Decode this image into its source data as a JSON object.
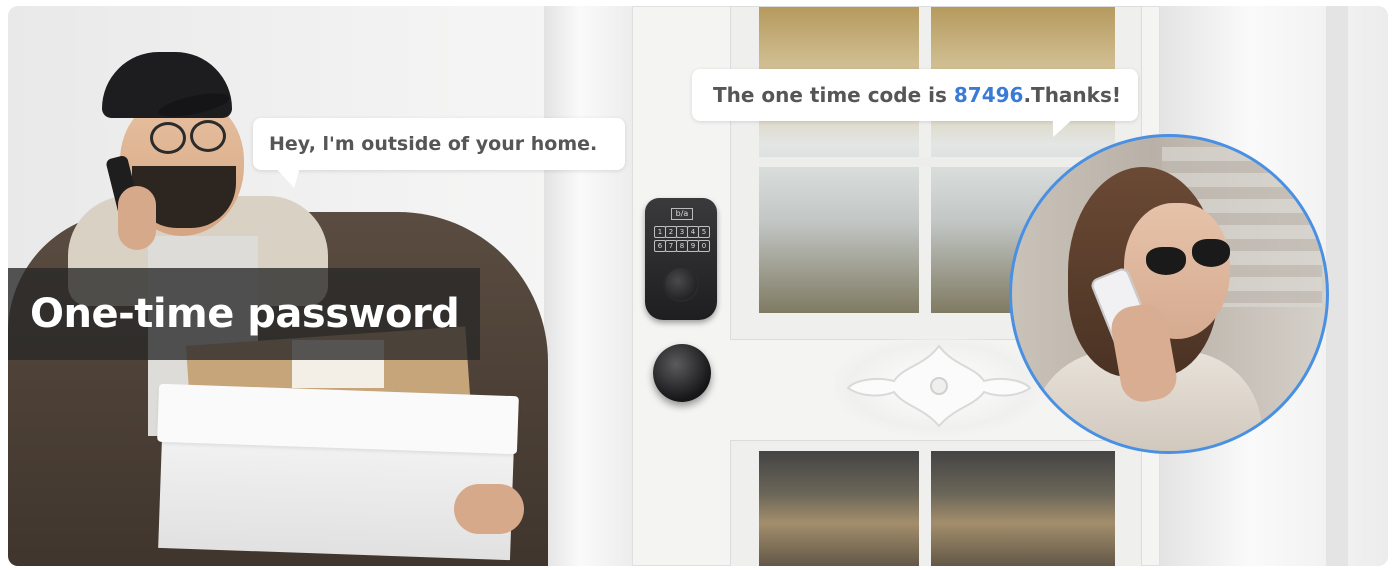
{
  "banner": {
    "title": "One-time password"
  },
  "speech": {
    "visitor": "Hey, l'm outside of your home.",
    "owner_prefix": "The one time code is ",
    "owner_code": "87496",
    "owner_suffix": ".Thanks!"
  },
  "lock": {
    "brand": "b/a",
    "keypad": [
      "1",
      "2",
      "3",
      "4",
      "5",
      "6",
      "7",
      "8",
      "9",
      "0"
    ]
  },
  "colors": {
    "code_highlight": "#3a7bd5",
    "circle_border": "#4a90e2",
    "banner_background": "#282828"
  }
}
